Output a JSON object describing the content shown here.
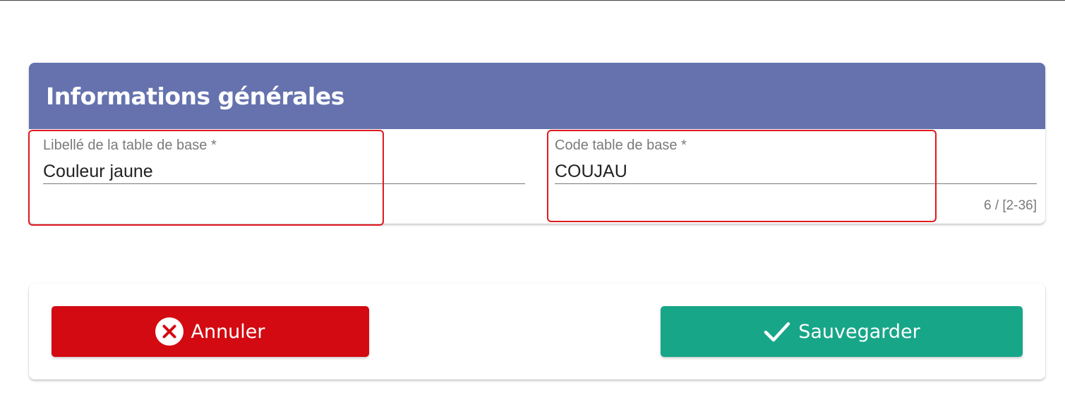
{
  "colors": {
    "header_bg": "#6572ae",
    "cancel_bg": "#d30a11",
    "save_bg": "#17a688",
    "highlight": "#e0191f"
  },
  "section": {
    "title": "Informations générales"
  },
  "fields": {
    "label_field": {
      "label": "Libellé de la table de base *",
      "value": "Couleur jaune"
    },
    "code_field": {
      "label": "Code table de base *",
      "value": "COUJAU",
      "counter": "6 / [2-36]"
    }
  },
  "actions": {
    "cancel": {
      "label": "Annuler",
      "icon": "cancel-circle-icon"
    },
    "save": {
      "label": "Sauvegarder",
      "icon": "checkmark-icon"
    }
  }
}
